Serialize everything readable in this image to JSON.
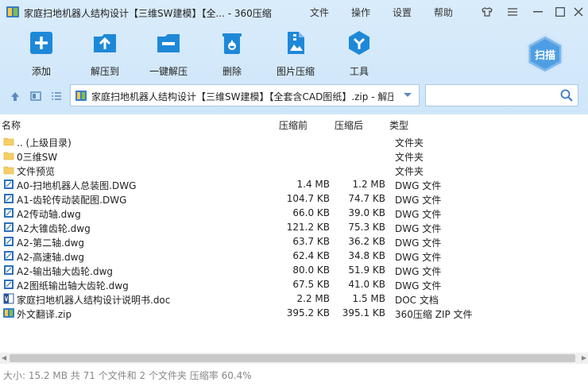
{
  "window": {
    "title": "家庭扫地机器人结构设计【三维SW建模】【全... - 360压缩",
    "menu": [
      "文件",
      "操作",
      "设置",
      "帮助"
    ]
  },
  "toolbar": {
    "items": [
      {
        "label": "添加",
        "icon": "add-icon"
      },
      {
        "label": "解压到",
        "icon": "extract-to-icon"
      },
      {
        "label": "一键解压",
        "icon": "one-click-extract-icon"
      },
      {
        "label": "删除",
        "icon": "trash-icon"
      },
      {
        "label": "图片压缩",
        "icon": "image-compress-icon"
      },
      {
        "label": "工具",
        "icon": "tools-icon"
      }
    ],
    "scan_label": "扫描"
  },
  "address": {
    "path": "家庭扫地机器人结构设计【三维SW建模】【全套含CAD图纸】.zip - 解压后..."
  },
  "columns": {
    "name": "名称",
    "packed": "压缩前",
    "unpacked": "压缩后",
    "type": "类型"
  },
  "files": [
    {
      "name": ".. (上级目录)",
      "packed": "",
      "unpacked": "",
      "type": "文件夹",
      "icon": "folder"
    },
    {
      "name": "0三维SW",
      "packed": "",
      "unpacked": "",
      "type": "文件夹",
      "icon": "folder"
    },
    {
      "name": "文件预览",
      "packed": "",
      "unpacked": "",
      "type": "文件夹",
      "icon": "folder"
    },
    {
      "name": "A0-扫地机器人总装图.DWG",
      "packed": "1.4 MB",
      "unpacked": "1.2 MB",
      "type": "DWG 文件",
      "icon": "dwg"
    },
    {
      "name": "A1-齿轮传动装配图.DWG",
      "packed": "104.7 KB",
      "unpacked": "74.7 KB",
      "type": "DWG 文件",
      "icon": "dwg"
    },
    {
      "name": "A2传动轴.dwg",
      "packed": "66.0 KB",
      "unpacked": "39.0 KB",
      "type": "DWG 文件",
      "icon": "dwg"
    },
    {
      "name": "A2大锥齿轮.dwg",
      "packed": "121.2 KB",
      "unpacked": "75.3 KB",
      "type": "DWG 文件",
      "icon": "dwg"
    },
    {
      "name": "A2-第二轴.dwg",
      "packed": "63.7 KB",
      "unpacked": "36.2 KB",
      "type": "DWG 文件",
      "icon": "dwg"
    },
    {
      "name": "A2-高速轴.dwg",
      "packed": "62.4 KB",
      "unpacked": "34.8 KB",
      "type": "DWG 文件",
      "icon": "dwg"
    },
    {
      "name": "A2-输出轴大齿轮.dwg",
      "packed": "80.0 KB",
      "unpacked": "51.9 KB",
      "type": "DWG 文件",
      "icon": "dwg"
    },
    {
      "name": "A2图纸输出轴大齿轮.dwg",
      "packed": "67.5 KB",
      "unpacked": "41.0 KB",
      "type": "DWG 文件",
      "icon": "dwg"
    },
    {
      "name": "家庭扫地机器人结构设计说明书.doc",
      "packed": "2.2 MB",
      "unpacked": "1.5 MB",
      "type": "DOC 文档",
      "icon": "doc"
    },
    {
      "name": "外文翻译.zip",
      "packed": "395.2 KB",
      "unpacked": "395.1 KB",
      "type": "360压缩 ZIP 文件",
      "icon": "zip"
    }
  ],
  "status": {
    "text": "大小: 15.2 MB 共 71 个文件和 2 个文件夹 压缩率 60.4%"
  },
  "colors": {
    "accent": "#1e88d8",
    "toolbar_bg": "#d3e8fb",
    "folder": "#f5cf63"
  }
}
